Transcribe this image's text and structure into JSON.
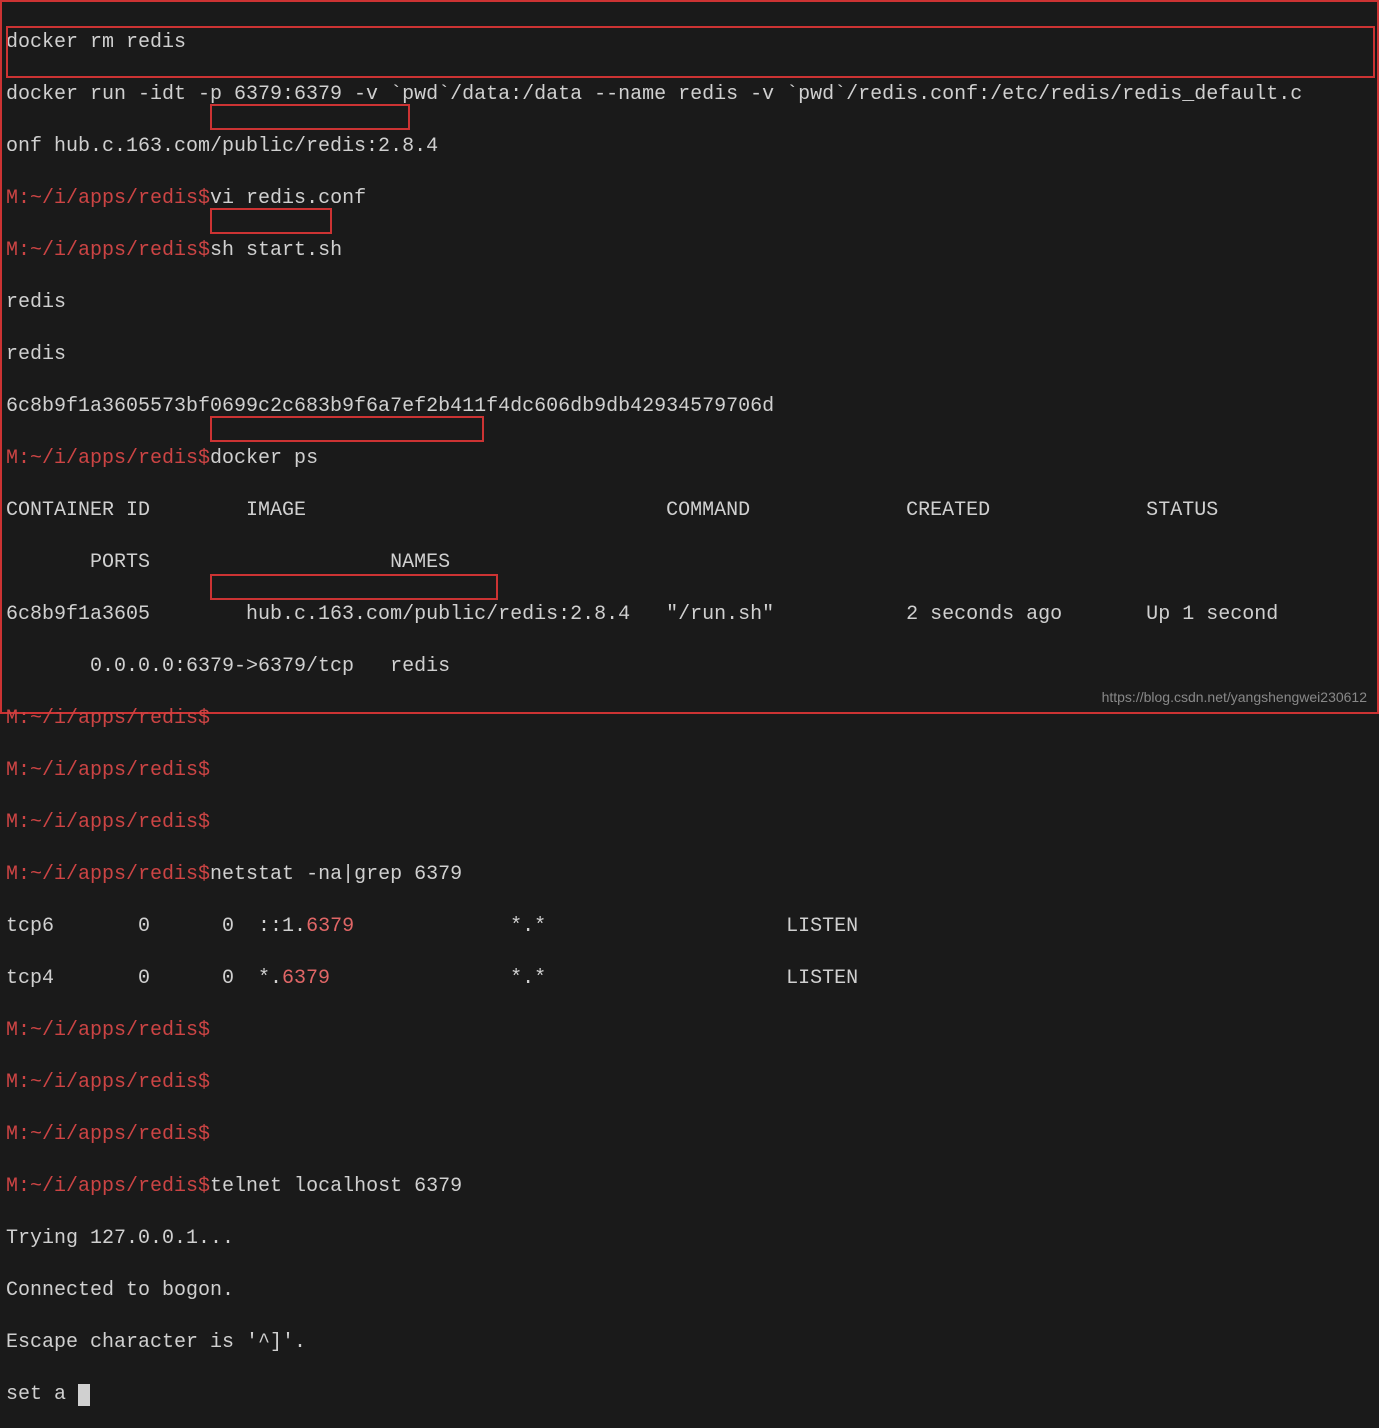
{
  "lines": {
    "l1": "docker rm redis",
    "l2": "docker run -idt -p 6379:6379 -v `pwd`/data:/data --name redis -v `pwd`/redis.conf:/etc/redis/redis_default.c",
    "l3": "onf hub.c.163.com/public/redis:2.8.4",
    "prompt": "M:~/i/apps/redis$",
    "l4": "vi redis.conf",
    "l5": "sh start.sh",
    "l6": "redis",
    "l7": "redis",
    "l8": "6c8b9f1a3605573bf0699c2c683b9f6a7ef2b411f4dc606db9db42934579706d",
    "l9": "docker ps",
    "header": "CONTAINER ID        IMAGE                              COMMAND             CREATED             STATUS",
    "header2": "       PORTS                    NAMES",
    "row1a": "6c8b9f1a3605        hub.c.163.com/public/redis:2.8.4   \"/run.sh\"           2 seconds ago       Up 1 second",
    "row1b": "       0.0.0.0:6379->6379/tcp   redis",
    "l12": "netstat -na|grep 6379",
    "tcp6a": "tcp6       0      0  ::1.",
    "port6379": "6379",
    "tcp6b": "             *.*                    LISTEN",
    "tcp4a": "tcp4       0      0  *.",
    "tcp4b": "               *.*                    LISTEN",
    "l13": "telnet localhost 6379",
    "l14": "Trying 127.0.0.1...",
    "l15": "Connected to bogon.",
    "l16": "Escape character is '^]'.",
    "l17": "set a "
  },
  "watermark": "https://blog.csdn.net/yangshengwei230612"
}
